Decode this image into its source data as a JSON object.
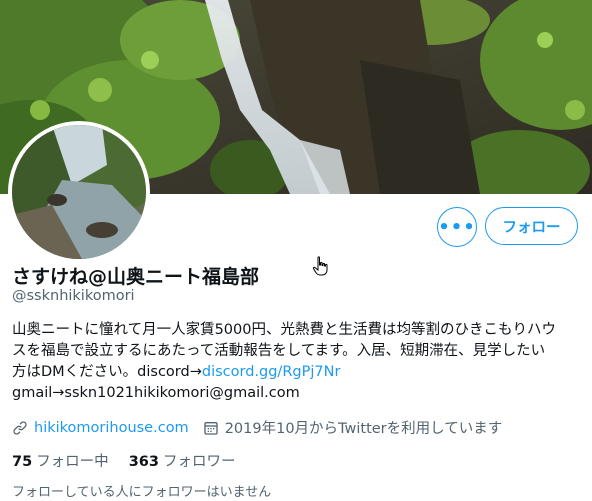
{
  "profile": {
    "display_name": "さすけね@山奥ニート福島部",
    "handle": "@ssknhikikomori",
    "bio_lines": [
      "山奥ニートに憧れて月一人家賃5000円、光熱費と生活費は均等割のひきこもりハウ",
      "スを福島で設立するにあたって活動報告をしてます。入居、短期滞在、見学したい"
    ],
    "bio_line3_prefix": "方はDMください。discord→",
    "bio_discord_link": "discord.gg/RgPj7Nr",
    "bio_line4": "gmail→sskn1021hikikomori@gmail.com",
    "website": "hikikomorihouse.com",
    "joined": "2019年10月からTwitterを利用しています",
    "following_count": "75",
    "following_label": "フォロー中",
    "followers_count": "363",
    "followers_label": "フォロワー",
    "mutual_note": "フォローしている人にフォロワーはいません"
  },
  "actions": {
    "more_label": "•••",
    "follow_label": "フォロー"
  },
  "icons": {
    "link": "link-icon",
    "calendar": "calendar-icon",
    "more": "more-dots-icon",
    "cursor": "hand-pointer-icon"
  },
  "colors": {
    "accent": "#1d9bf0",
    "secondary_text": "#536471",
    "primary_text": "#0f1419"
  }
}
